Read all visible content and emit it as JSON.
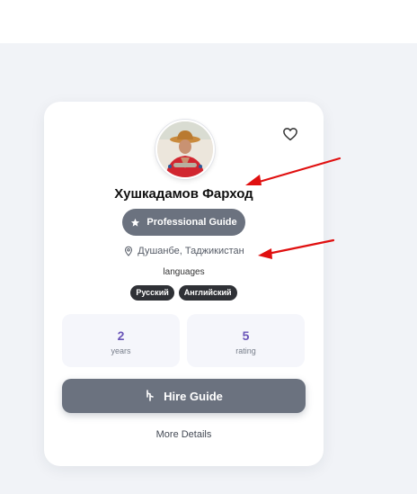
{
  "guide": {
    "name": "Хушкадамов Фарход",
    "role": "Professional Guide",
    "location": "Душанбе, Таджикистан",
    "languages_title": "languages",
    "languages": [
      "Русский",
      "Английский"
    ],
    "stats": [
      {
        "value": "2",
        "label": "years"
      },
      {
        "value": "5",
        "label": "rating"
      }
    ],
    "hire_label": "Hire Guide",
    "more_label": "More Details"
  },
  "icons": {
    "favorite": "heart-icon",
    "role": "star-icon",
    "location": "map-pin-icon",
    "hire": "hand-pointer-icon"
  },
  "colors": {
    "badge_bg": "#6b727f",
    "stat_value": "#6a55b8",
    "chip_bg": "#2f3136",
    "annotation_arrow": "#e01010"
  }
}
